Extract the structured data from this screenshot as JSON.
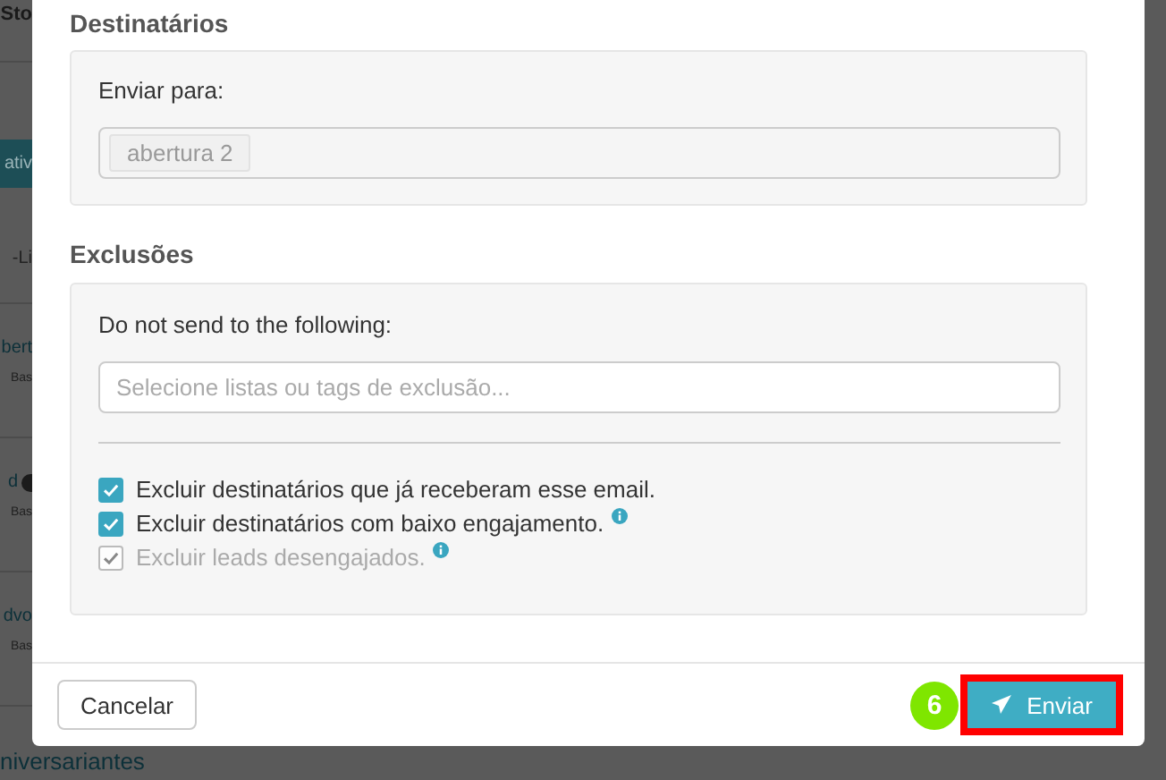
{
  "background_page": {
    "title": "Sto",
    "filter_button": "ativ",
    "column_header": "-Li",
    "rows": [
      {
        "name": "bert",
        "subtitle": "Bas",
        "badge": false
      },
      {
        "name": "d",
        "subtitle": "Bas",
        "badge": true
      },
      {
        "name": "dvo",
        "subtitle": "Bas",
        "badge": false
      }
    ],
    "bottom_row_name": "niversariantes"
  },
  "recipients": {
    "heading": "Destinatários",
    "label": "Enviar para:",
    "tags": [
      "abertura 2"
    ]
  },
  "exclusions": {
    "heading": "Exclusões",
    "label": "Do not send to the following:",
    "placeholder": "Selecione listas ou tags de exclusão...",
    "options": [
      {
        "label": "Excluir destinatários que já receberam esse email.",
        "checked": true,
        "disabled": false,
        "info": false
      },
      {
        "label": "Excluir destinatários com baixo engajamento.",
        "checked": true,
        "disabled": false,
        "info": true
      },
      {
        "label": "Excluir leads desengajados.",
        "checked": true,
        "disabled": true,
        "info": true
      }
    ]
  },
  "footer": {
    "cancel": "Cancelar",
    "submit": "Enviar",
    "step_number": "6",
    "highlighted": true
  }
}
